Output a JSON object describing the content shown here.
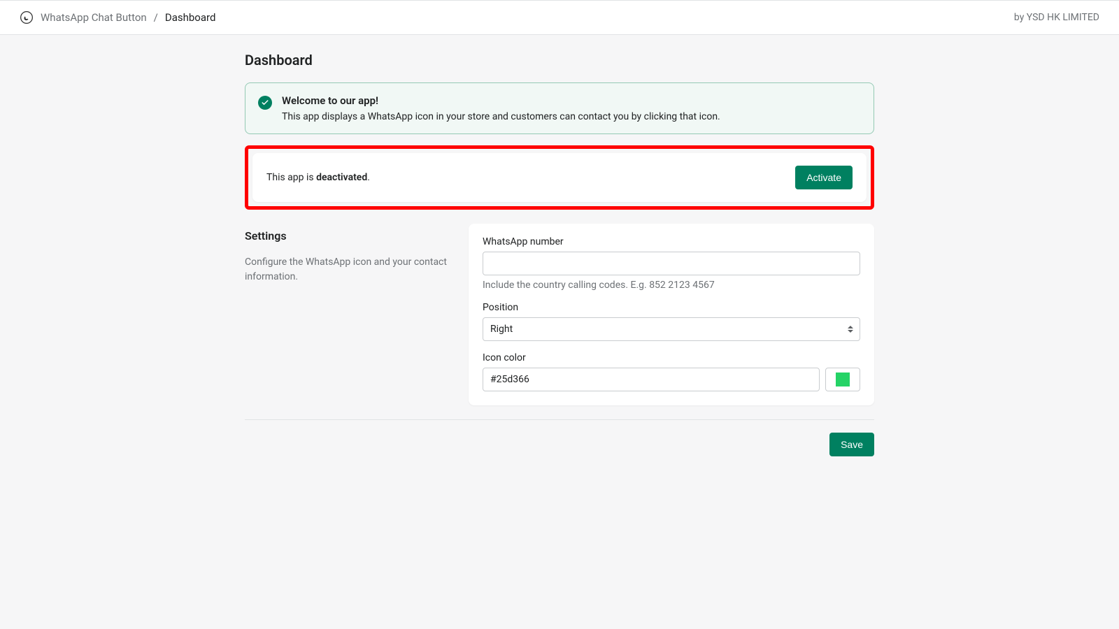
{
  "breadcrumb": {
    "app_name": "WhatsApp Chat Button",
    "separator": "/",
    "current": "Dashboard"
  },
  "byline": "by YSD HK LIMITED",
  "page_title": "Dashboard",
  "banner": {
    "title": "Welcome to our app!",
    "description": "This app displays a WhatsApp icon in your store and customers can contact you by clicking that icon."
  },
  "status": {
    "prefix": "This app is ",
    "state": "deactivated",
    "suffix": ".",
    "activate_label": "Activate"
  },
  "settings": {
    "heading": "Settings",
    "description": "Configure the WhatsApp icon and your contact information.",
    "whatsapp_number": {
      "label": "WhatsApp number",
      "value": "",
      "help": "Include the country calling codes. E.g. 852 2123 4567"
    },
    "position": {
      "label": "Position",
      "selected": "Right"
    },
    "icon_color": {
      "label": "Icon color",
      "value": "#25d366"
    }
  },
  "footer": {
    "save_label": "Save"
  }
}
